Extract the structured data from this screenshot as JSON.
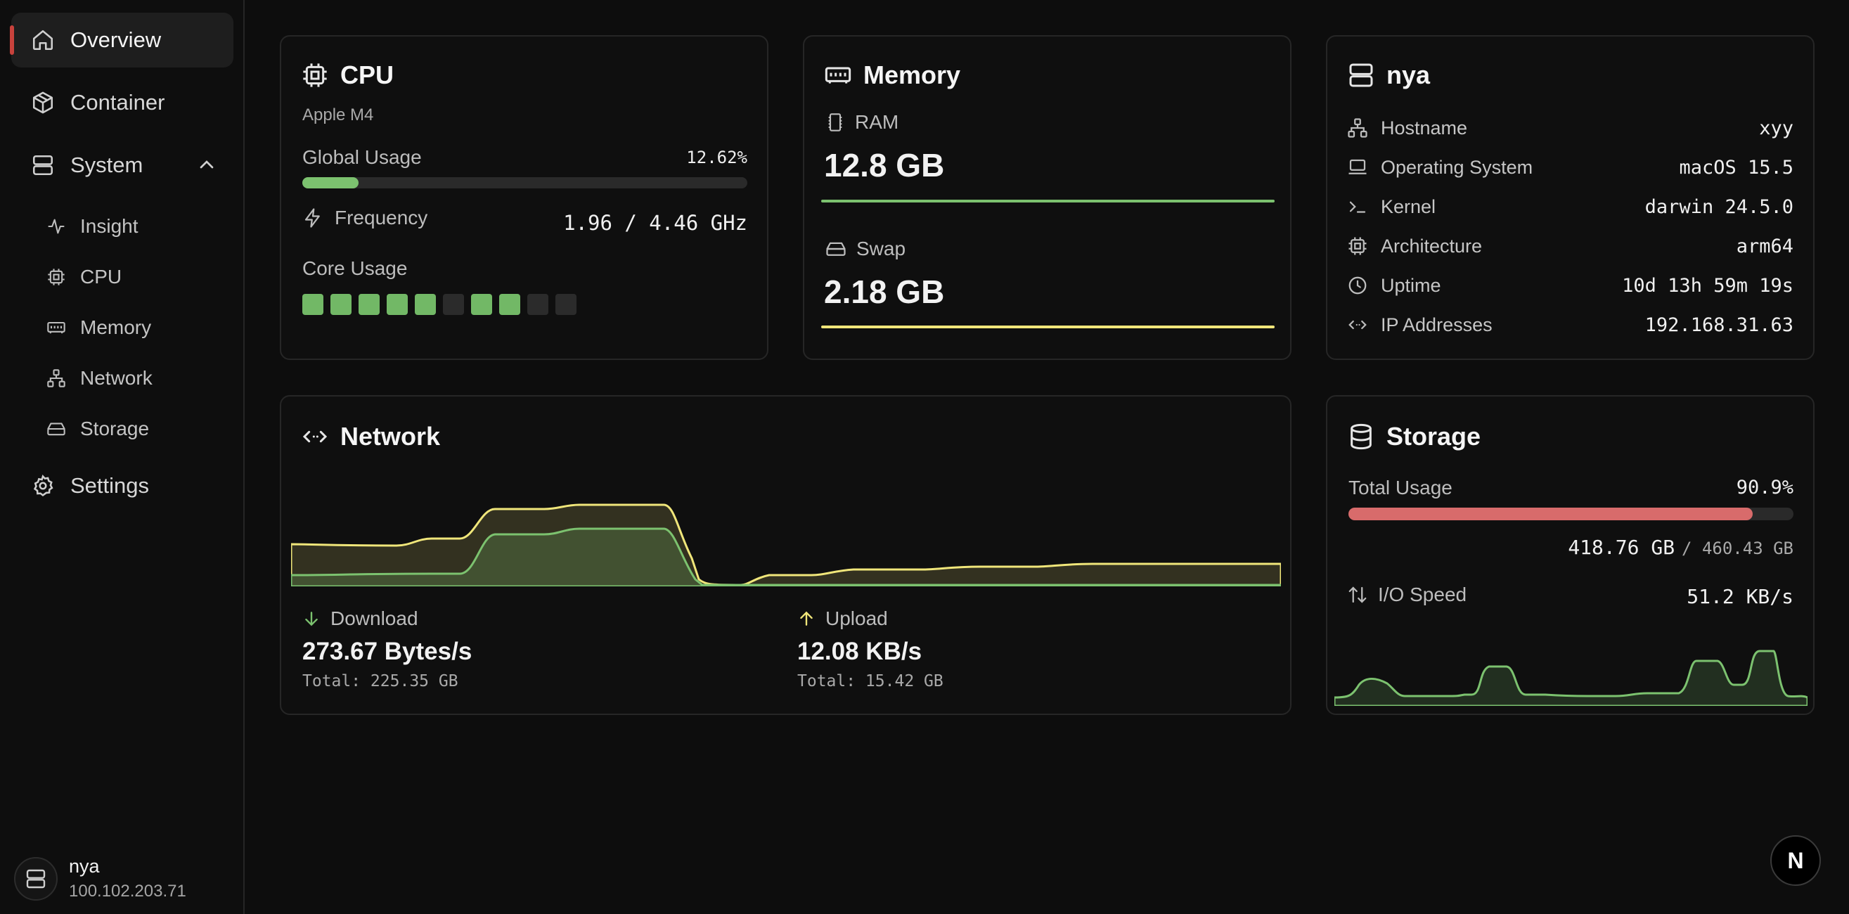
{
  "sidebar": {
    "items": [
      {
        "label": "Overview",
        "icon": "home-icon"
      },
      {
        "label": "Container",
        "icon": "box-icon"
      },
      {
        "label": "System",
        "icon": "server-icon"
      },
      {
        "label": "Settings",
        "icon": "gear-icon"
      }
    ],
    "sub_items": [
      {
        "label": "Insight",
        "icon": "activity-icon"
      },
      {
        "label": "CPU",
        "icon": "cpu-icon"
      },
      {
        "label": "Memory",
        "icon": "memory-icon"
      },
      {
        "label": "Network",
        "icon": "network-icon"
      },
      {
        "label": "Storage",
        "icon": "hard-drive-icon"
      }
    ],
    "user": {
      "name": "nya",
      "ip": "100.102.203.71"
    }
  },
  "cpu": {
    "title": "CPU",
    "model": "Apple M4",
    "global_usage_label": "Global Usage",
    "global_usage_value": "12.62%",
    "global_usage_fraction": 0.1262,
    "frequency_label": "Frequency",
    "frequency_value": "1.96 / 4.46 GHz",
    "core_usage_label": "Core Usage",
    "cores_active": [
      true,
      true,
      true,
      true,
      true,
      false,
      true,
      true,
      false,
      false
    ]
  },
  "memory": {
    "title": "Memory",
    "ram_label": "RAM",
    "ram_value": "12.8 GB",
    "swap_label": "Swap",
    "swap_value": "2.18 GB",
    "ram_color": "#7cc26f",
    "swap_color": "#f0e67a"
  },
  "host": {
    "title": "nya",
    "rows": [
      {
        "label": "Hostname",
        "value": "xyy",
        "icon": "network-icon"
      },
      {
        "label": "Operating System",
        "value": "macOS 15.5",
        "icon": "laptop-icon"
      },
      {
        "label": "Kernel",
        "value": "darwin 24.5.0",
        "icon": "terminal-icon"
      },
      {
        "label": "Architecture",
        "value": "arm64",
        "icon": "cpu-icon"
      },
      {
        "label": "Uptime",
        "value": "10d 13h 59m 19s",
        "icon": "clock-icon"
      },
      {
        "label": "IP Addresses",
        "value": "192.168.31.63",
        "icon": "code-icon"
      }
    ]
  },
  "network": {
    "title": "Network",
    "download_label": "Download",
    "download_value": "273.67 Bytes/s",
    "download_total": "Total: 225.35 GB",
    "upload_label": "Upload",
    "upload_value": "12.08 KB/s",
    "upload_total": "Total: 15.42 GB",
    "download_color": "#7cc26f",
    "upload_color": "#f0e67a"
  },
  "storage": {
    "title": "Storage",
    "total_usage_label": "Total Usage",
    "total_usage_value": "90.9%",
    "total_usage_fraction": 0.909,
    "used": "418.76 GB",
    "capacity": "/ 460.43 GB",
    "io_label": "I/O Speed",
    "io_value": "51.2 KB/s",
    "bar_color": "#d86b6b"
  },
  "fab": {
    "label": "N"
  }
}
